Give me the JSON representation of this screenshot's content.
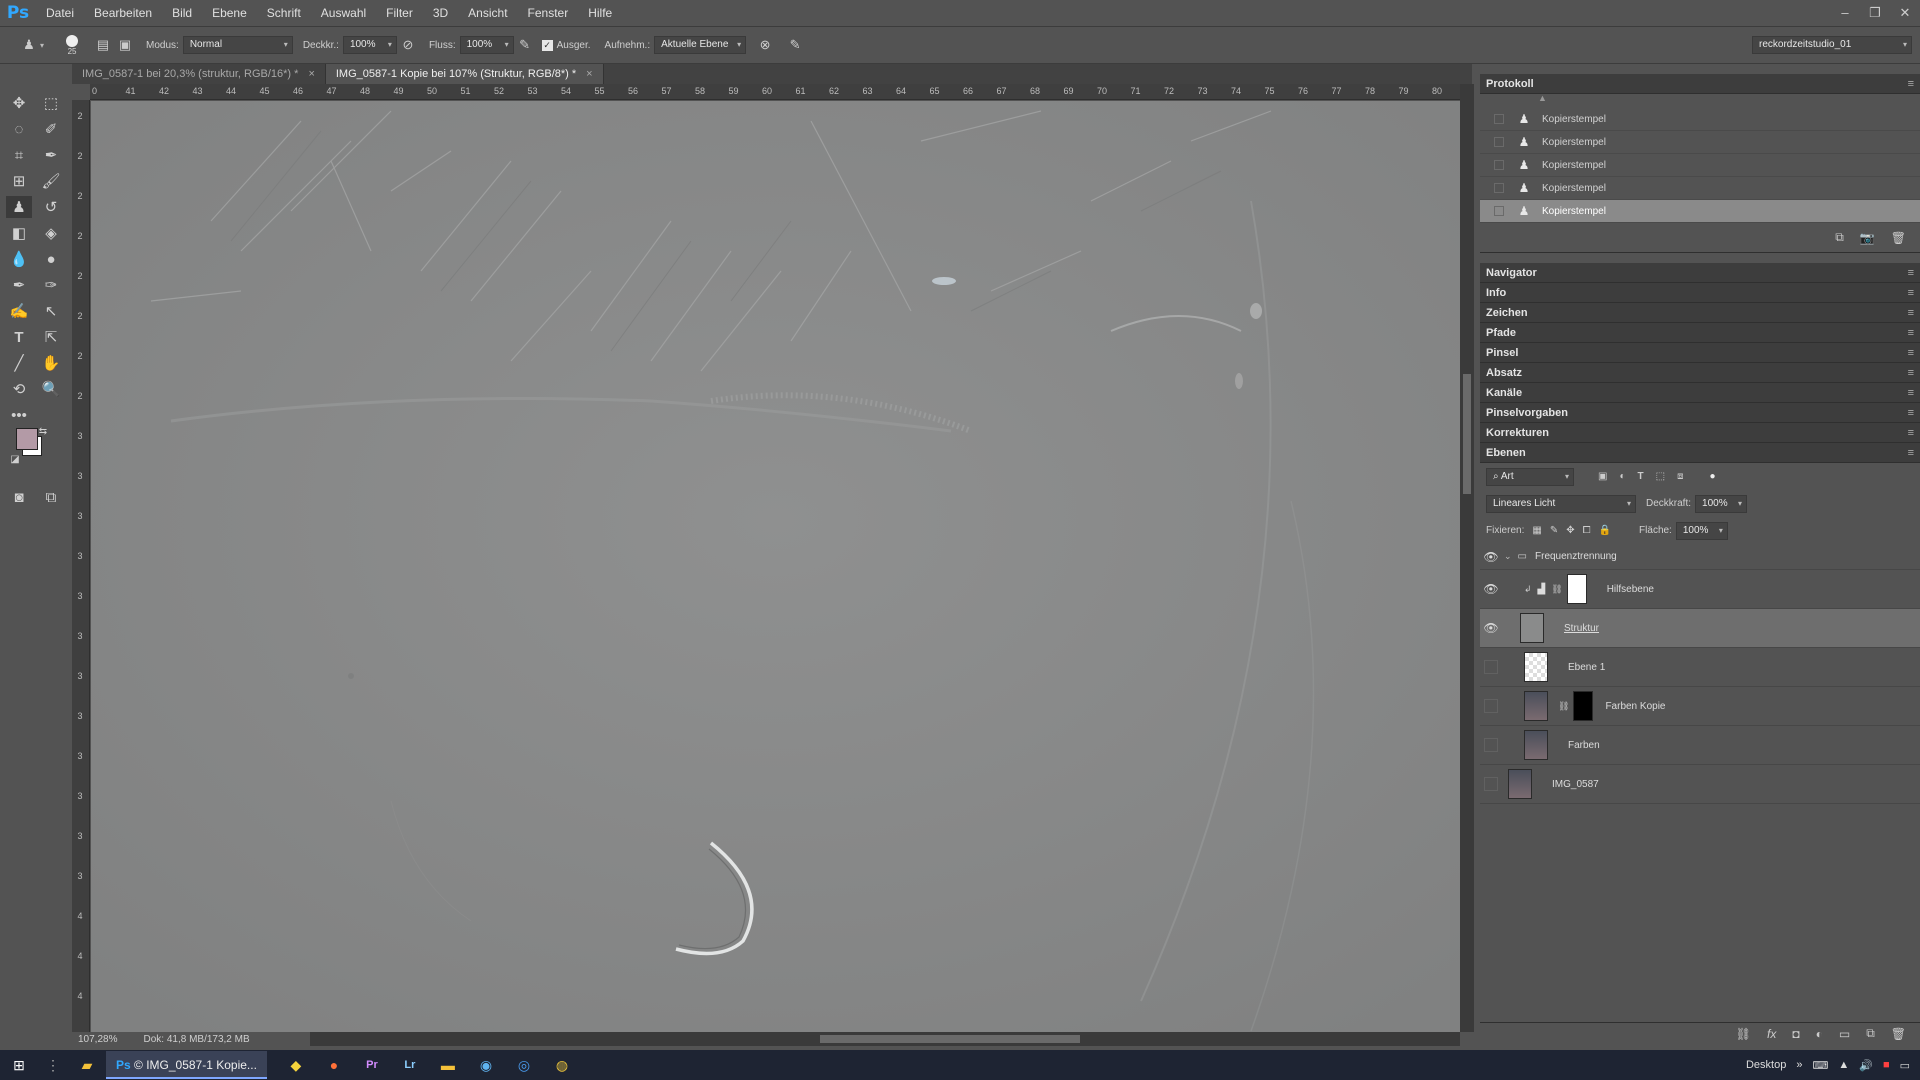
{
  "menubar": {
    "logo": "Ps",
    "items": [
      "Datei",
      "Bearbeiten",
      "Bild",
      "Ebene",
      "Schrift",
      "Auswahl",
      "Filter",
      "3D",
      "Ansicht",
      "Fenster",
      "Hilfe"
    ]
  },
  "options": {
    "brush_size": "25",
    "mode_label": "Modus:",
    "mode_value": "Normal",
    "opacity_label": "Deckkr.:",
    "opacity_value": "100%",
    "flow_label": "Fluss:",
    "flow_value": "100%",
    "aligned_label": "Ausger.",
    "sample_label": "Aufnehm.:",
    "sample_value": "Aktuelle Ebene",
    "workspace": "reckordzeitstudio_01"
  },
  "tabs": [
    {
      "label": "IMG_0587-1 bei 20,3% (struktur, RGB/16*) *",
      "active": false
    },
    {
      "label": "IMG_0587-1 Kopie bei 107% (Struktur, RGB/8*) *",
      "active": true
    }
  ],
  "ruler_h": [
    "0",
    "41",
    "42",
    "43",
    "44",
    "45",
    "46",
    "47",
    "48",
    "49",
    "50",
    "51",
    "52",
    "53",
    "54",
    "55",
    "56",
    "57",
    "58",
    "59",
    "60",
    "61",
    "62",
    "63",
    "64",
    "65",
    "66",
    "67",
    "68",
    "69",
    "70",
    "71",
    "72",
    "73",
    "74",
    "75",
    "76",
    "77",
    "78",
    "79",
    "80"
  ],
  "ruler_v": [
    "2",
    "2",
    "2",
    "2",
    "2",
    "2",
    "2",
    "2",
    "3",
    "3",
    "3",
    "3",
    "3",
    "3",
    "3",
    "3",
    "3",
    "3",
    "3",
    "3",
    "4",
    "4",
    "4"
  ],
  "status": {
    "zoom": "107,28%",
    "doc": "Dok: 41,8 MB/173,2 MB"
  },
  "history": {
    "title": "Protokoll",
    "items": [
      "Kopierstempel",
      "Kopierstempel",
      "Kopierstempel",
      "Kopierstempel",
      "Kopierstempel",
      "Kopierstempel"
    ]
  },
  "collapsed_panels": [
    "Navigator",
    "Info",
    "Zeichen",
    "Pfade",
    "Pinsel",
    "Absatz",
    "Kanäle",
    "Pinselvorgaben",
    "Korrekturen"
  ],
  "layers": {
    "title": "Ebenen",
    "filter_kind": "Art",
    "blend_mode": "Lineares Licht",
    "opacity_label": "Deckkraft:",
    "opacity_value": "100%",
    "lock_label": "Fixieren:",
    "fill_label": "Fläche:",
    "fill_value": "100%",
    "group_name": "Frequenztrennung",
    "rows": [
      {
        "name": "Hilfsebene",
        "visible": true
      },
      {
        "name": "Struktur",
        "visible": true
      },
      {
        "name": "Ebene 1",
        "visible": false
      },
      {
        "name": "Farben Kopie",
        "visible": false
      },
      {
        "name": "Farben",
        "visible": false
      },
      {
        "name": "IMG_0587",
        "visible": false
      }
    ]
  },
  "taskbar": {
    "active_app": "© IMG_0587-1 Kopie...",
    "desktop_label": "Desktop"
  },
  "colors": {
    "foreground": "#b39aa6",
    "background": "#ffffff",
    "canvas": "#8a8b8b"
  }
}
